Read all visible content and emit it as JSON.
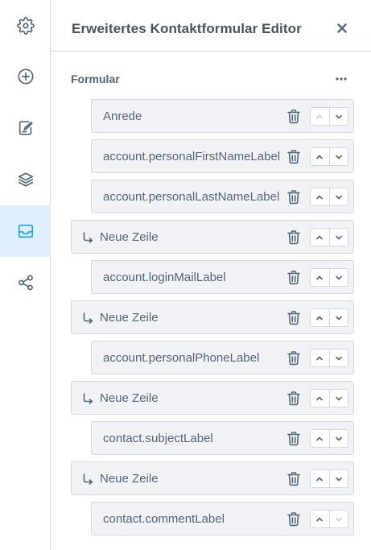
{
  "sidebar": {
    "items": [
      {
        "icon": "gear-icon",
        "active": false
      },
      {
        "icon": "plus-circle-icon",
        "active": false
      },
      {
        "icon": "edit-icon",
        "active": false
      },
      {
        "icon": "layers-icon",
        "active": false
      },
      {
        "icon": "inbox-icon",
        "active": true
      },
      {
        "icon": "share-icon",
        "active": false
      }
    ]
  },
  "header": {
    "title": "Erweitertes Kontaktformular Editor",
    "close_icon": "close-icon"
  },
  "form": {
    "section_label": "Formular",
    "more_icon": "more-icon",
    "rows": [
      {
        "type": "field",
        "label": "Anrede",
        "up_disabled": true,
        "down_disabled": false
      },
      {
        "type": "field",
        "label": "account.personalFirstNameLabel",
        "up_disabled": false,
        "down_disabled": false
      },
      {
        "type": "field",
        "label": "account.personalLastNameLabel",
        "up_disabled": false,
        "down_disabled": false
      },
      {
        "type": "newline",
        "label": "Neue Zeile",
        "up_disabled": false,
        "down_disabled": false
      },
      {
        "type": "field",
        "label": "account.loginMailLabel",
        "up_disabled": false,
        "down_disabled": false
      },
      {
        "type": "newline",
        "label": "Neue Zeile",
        "up_disabled": false,
        "down_disabled": false
      },
      {
        "type": "field",
        "label": "account.personalPhoneLabel",
        "up_disabled": false,
        "down_disabled": false
      },
      {
        "type": "newline",
        "label": "Neue Zeile",
        "up_disabled": false,
        "down_disabled": false
      },
      {
        "type": "field",
        "label": "contact.subjectLabel",
        "up_disabled": false,
        "down_disabled": false
      },
      {
        "type": "newline",
        "label": "Neue Zeile",
        "up_disabled": false,
        "down_disabled": false
      },
      {
        "type": "field",
        "label": "contact.commentLabel",
        "up_disabled": false,
        "down_disabled": true
      }
    ]
  },
  "colors": {
    "accent": "#e0effd",
    "icon": "#52667a",
    "border": "#d1d9e0",
    "row_bg": "#f0f2f5"
  }
}
